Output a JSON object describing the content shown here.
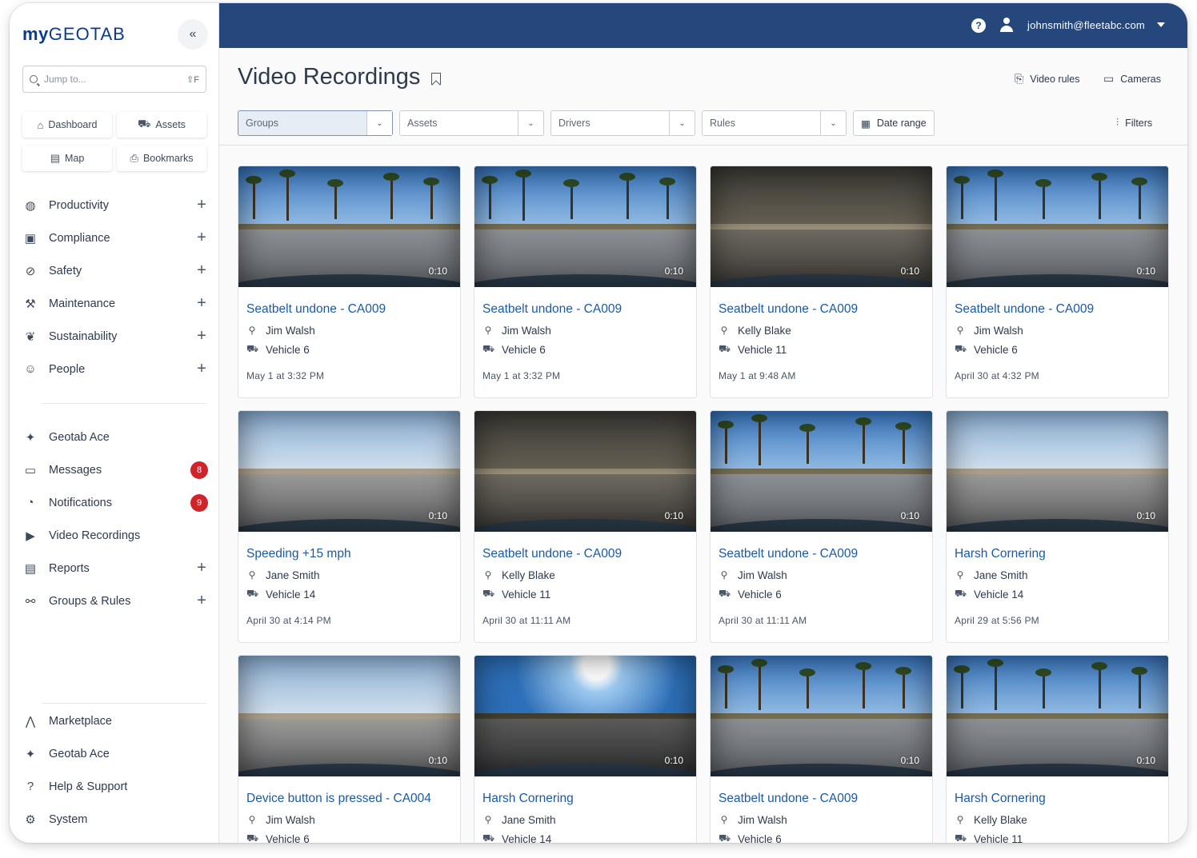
{
  "app": {
    "logo_my": "my",
    "logo_geotab": "GEOTAB",
    "collapse_glyph": "«",
    "search_placeholder": "Jump to...",
    "search_shortcut": "⇧F"
  },
  "quick_links": [
    {
      "label": "Dashboard",
      "icon": "home-icon",
      "glyph": "⌂"
    },
    {
      "label": "Assets",
      "icon": "truck-icon",
      "glyph": "⛟"
    },
    {
      "label": "Map",
      "icon": "map-icon",
      "glyph": "▤"
    },
    {
      "label": "Bookmarks",
      "icon": "bookmark-icon",
      "glyph": "⎙"
    }
  ],
  "nav_main": [
    {
      "label": "Productivity",
      "icon": "globe-icon",
      "glyph": "◍",
      "expandable": "+"
    },
    {
      "label": "Compliance",
      "icon": "clipboard-icon",
      "glyph": "▣",
      "expandable": "+"
    },
    {
      "label": "Safety",
      "icon": "bandage-icon",
      "glyph": "⊘",
      "expandable": "+"
    },
    {
      "label": "Maintenance",
      "icon": "wrench-icon",
      "glyph": "⚒",
      "expandable": "+"
    },
    {
      "label": "Sustainability",
      "icon": "leaf-icon",
      "glyph": "❦",
      "expandable": "+"
    },
    {
      "label": "People",
      "icon": "people-icon",
      "glyph": "☺",
      "expandable": "+"
    }
  ],
  "nav_secondary": [
    {
      "label": "Geotab Ace",
      "icon": "sparkle-icon",
      "glyph": "✦"
    },
    {
      "label": "Messages",
      "icon": "messages-icon",
      "glyph": "▭",
      "badge": "8"
    },
    {
      "label": "Notifications",
      "icon": "bell-icon",
      "glyph": "◔",
      "badge": "9"
    },
    {
      "label": "Video Recordings",
      "icon": "video-icon",
      "glyph": "▶"
    },
    {
      "label": "Reports",
      "icon": "document-icon",
      "glyph": "▤",
      "expandable": "+"
    },
    {
      "label": "Groups & Rules",
      "icon": "hierarchy-icon",
      "glyph": "⚯",
      "expandable": "+"
    }
  ],
  "nav_footer": [
    {
      "label": "Marketplace",
      "icon": "marketplace-icon",
      "glyph": "⋀"
    },
    {
      "label": "Geotab Ace",
      "icon": "sparkle-icon",
      "glyph": "✦"
    },
    {
      "label": "Help & Support",
      "icon": "help-circle-icon",
      "glyph": "?"
    },
    {
      "label": "System",
      "icon": "gear-icon",
      "glyph": "⚙"
    }
  ],
  "topbar": {
    "help_glyph": "?",
    "email": "johnsmith@fleetabc.com"
  },
  "header": {
    "title": "Video Recordings",
    "video_rules": "Video rules",
    "cameras": "Cameras",
    "filters": "Filters"
  },
  "filters": {
    "groups": "Groups",
    "assets": "Assets",
    "drivers": "Drivers",
    "rules": "Rules",
    "date_range": "Date range"
  },
  "recordings": [
    {
      "title": "Seatbelt undone - CA009",
      "driver": "Jim Walsh",
      "vehicle": "Vehicle 6",
      "date": "May 1 at 3:32 PM",
      "duration": "0:10",
      "scene": "day"
    },
    {
      "title": "Seatbelt undone - CA009",
      "driver": "Jim Walsh",
      "vehicle": "Vehicle 6",
      "date": "May 1 at 3:32 PM",
      "duration": "0:10",
      "scene": "day"
    },
    {
      "title": "Seatbelt undone - CA009",
      "driver": "Kelly Blake",
      "vehicle": "Vehicle 11",
      "date": "May 1 at 9:48 AM",
      "duration": "0:10",
      "scene": "garage"
    },
    {
      "title": "Seatbelt undone - CA009",
      "driver": "Jim Walsh",
      "vehicle": "Vehicle 6",
      "date": "April 30 at 4:32 PM",
      "duration": "0:10",
      "scene": "day"
    },
    {
      "title": "Speeding +15 mph",
      "driver": "Jane Smith",
      "vehicle": "Vehicle 14",
      "date": "April 30 at 4:14 PM",
      "duration": "0:10",
      "scene": "hwy"
    },
    {
      "title": "Seatbelt undone - CA009",
      "driver": "Kelly Blake",
      "vehicle": "Vehicle 11",
      "date": "April 30 at 11:11 AM",
      "duration": "0:10",
      "scene": "garage"
    },
    {
      "title": "Seatbelt undone - CA009",
      "driver": "Jim Walsh",
      "vehicle": "Vehicle 6",
      "date": "April 30 at 11:11 AM",
      "duration": "0:10",
      "scene": "day"
    },
    {
      "title": "Harsh Cornering",
      "driver": "Jane Smith",
      "vehicle": "Vehicle 14",
      "date": "April 29 at 5:56 PM",
      "duration": "0:10",
      "scene": "hwy"
    },
    {
      "title": "Device button is pressed - CA004",
      "driver": "Jim Walsh",
      "vehicle": "Vehicle 6",
      "date": "",
      "duration": "0:10",
      "scene": "hwy"
    },
    {
      "title": "Harsh Cornering",
      "driver": "Jane Smith",
      "vehicle": "Vehicle 14",
      "date": "",
      "duration": "0:10",
      "scene": "sun"
    },
    {
      "title": "Seatbelt undone - CA009",
      "driver": "Jim Walsh",
      "vehicle": "Vehicle 6",
      "date": "",
      "duration": "0:10",
      "scene": "day"
    },
    {
      "title": "Harsh Cornering",
      "driver": "Kelly Blake",
      "vehicle": "Vehicle 11",
      "date": "",
      "duration": "0:10",
      "scene": "day"
    }
  ],
  "icons": {
    "driver": "person-icon",
    "vehicle": "truck-icon"
  },
  "colors": {
    "topbar": "#25477b",
    "link": "#1a5aa5",
    "badge": "#d0242b"
  }
}
